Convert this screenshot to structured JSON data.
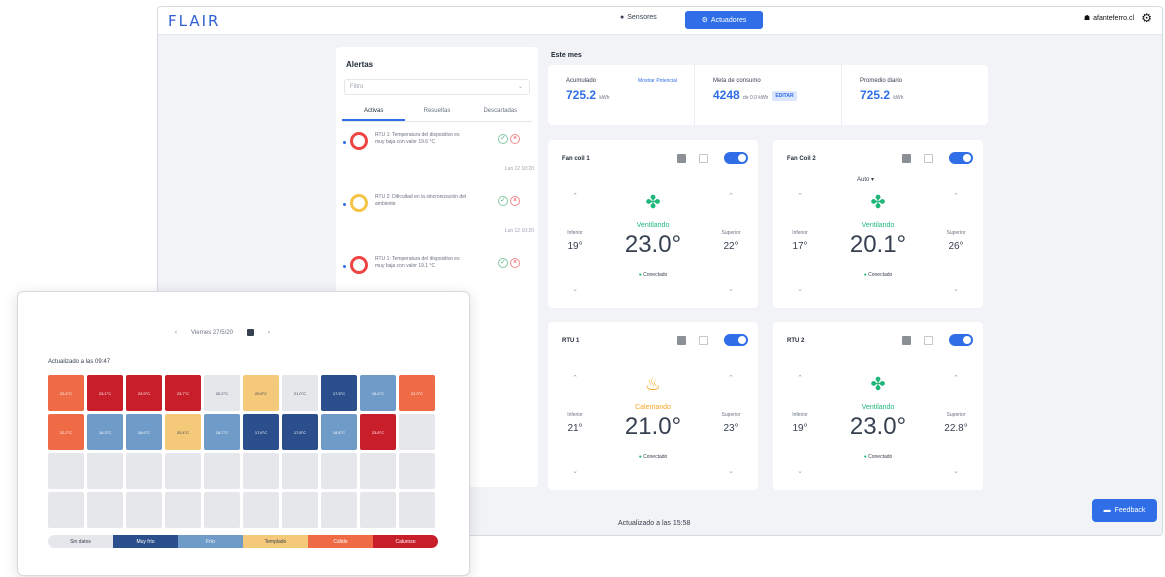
{
  "app": {
    "logo": "FLAIR"
  },
  "nav": {
    "sensores": "Sensores",
    "actuadores": "Actuadores"
  },
  "user": {
    "email": "afanteferro.cl"
  },
  "alerts": {
    "title": "Alertas",
    "filter_placeholder": "Filtro",
    "tabs": [
      "Activas",
      "Resueltas",
      "Descartadas"
    ],
    "items": [
      {
        "text": "RTU 1: Temperatura del dispositivo es muy baja con valor 19.6 °C",
        "time": "Lun 12 10:20",
        "color": "red"
      },
      {
        "text": "RTU 2: Dificultad en la sincronización del ambiente",
        "time": "Lun 12 10:20",
        "color": "yellow"
      },
      {
        "text": "RTU 1: Temperatura del dispositivo es muy baja con valor 19.1 °C",
        "time": "",
        "color": "red"
      }
    ]
  },
  "month": {
    "title": "Este mes"
  },
  "stats": [
    {
      "label": "Acumulado",
      "value": "725.2",
      "unit": "kWh",
      "link": "Mostrar Potencial",
      "chip": ""
    },
    {
      "label": "Meta de consumo",
      "value": "4248",
      "unit": "de 0.0 kWh",
      "link": "",
      "chip": "EDITAR"
    },
    {
      "label": "Promedio diario",
      "value": "725.2",
      "unit": "kWh",
      "link": "",
      "chip": ""
    }
  ],
  "cards": [
    {
      "name": "Fan coil 1",
      "modo": "",
      "mode_label": "Ventilando",
      "mode_icon": "fan-icon",
      "temp": "23.0°",
      "inferior_label": "Inferior",
      "inferior": "19°",
      "superior_label": "Superior",
      "superior": "22°",
      "status": "Conectado"
    },
    {
      "name": "Fan Coil 2",
      "modo": "Auto ▾",
      "mode_label": "Ventilando",
      "mode_icon": "fan-icon",
      "temp": "20.1°",
      "inferior_label": "Inferior",
      "inferior": "17°",
      "superior_label": "Superior",
      "superior": "26°",
      "status": "Conectado"
    },
    {
      "name": "RTU 1",
      "modo": "",
      "mode_label": "Calentando",
      "mode_icon": "flame-icon",
      "temp": "21.0°",
      "inferior_label": "Inferior",
      "inferior": "21°",
      "superior_label": "Superior",
      "superior": "23°",
      "status": "Conectado"
    },
    {
      "name": "RTU 2",
      "modo": "",
      "mode_label": "Ventilando",
      "mode_icon": "fan-icon",
      "temp": "23.0°",
      "inferior_label": "Inferior",
      "inferior": "19°",
      "superior_label": "Superior",
      "superior": "22.8°",
      "status": "Conectado"
    }
  ],
  "footer": {
    "updated": "Actualizado a las 15:58"
  },
  "feedback": {
    "label": "Feedback"
  },
  "heatmap": {
    "date": "Viernes 27/5/20",
    "updated": "Actualizado a las 09:47",
    "colors": {
      "C0": "#e5e7eb",
      "C1": "#2b4f8c",
      "C2": "#6f9bc8",
      "C3": "#f5c97a",
      "C4": "#ef6b45",
      "C5": "#c81e2a"
    },
    "cells": [
      {
        "c": "C4",
        "t": "22.4°C"
      },
      {
        "c": "C5",
        "t": "23.1°C"
      },
      {
        "c": "C5",
        "t": "23.9°C"
      },
      {
        "c": "C5",
        "t": "23.7°C"
      },
      {
        "c": "C0",
        "t": "20.2°C"
      },
      {
        "c": "C3",
        "t": "20.8°C"
      },
      {
        "c": "C0",
        "t": "21.0°C"
      },
      {
        "c": "C1",
        "t": "17.5°C"
      },
      {
        "c": "C2",
        "t": "18.4°C"
      },
      {
        "c": "C4",
        "t": "22.0°C"
      },
      {
        "c": "C4",
        "t": "22.2°C"
      },
      {
        "c": "C2",
        "t": "18.3°C"
      },
      {
        "c": "C2",
        "t": "18.6°C"
      },
      {
        "c": "C3",
        "t": "20.4°C"
      },
      {
        "c": "C2",
        "t": "18.7°C"
      },
      {
        "c": "C1",
        "t": "17.6°C"
      },
      {
        "c": "C1",
        "t": "17.8°C"
      },
      {
        "c": "C2",
        "t": "18.8°C"
      },
      {
        "c": "C5",
        "t": "23.8°C"
      },
      {
        "c": "C0",
        "t": ""
      },
      {
        "c": "C0",
        "t": ""
      },
      {
        "c": "C0",
        "t": ""
      },
      {
        "c": "C0",
        "t": ""
      },
      {
        "c": "C0",
        "t": ""
      },
      {
        "c": "C0",
        "t": ""
      },
      {
        "c": "C0",
        "t": ""
      },
      {
        "c": "C0",
        "t": ""
      },
      {
        "c": "C0",
        "t": ""
      },
      {
        "c": "C0",
        "t": ""
      },
      {
        "c": "C0",
        "t": ""
      },
      {
        "c": "C0",
        "t": ""
      },
      {
        "c": "C0",
        "t": ""
      },
      {
        "c": "C0",
        "t": ""
      },
      {
        "c": "C0",
        "t": ""
      },
      {
        "c": "C0",
        "t": ""
      },
      {
        "c": "C0",
        "t": ""
      },
      {
        "c": "C0",
        "t": ""
      },
      {
        "c": "C0",
        "t": ""
      },
      {
        "c": "C0",
        "t": ""
      },
      {
        "c": "C0",
        "t": ""
      }
    ],
    "legend": [
      {
        "label": "Sin datos",
        "c": "C0"
      },
      {
        "label": "Muy frío",
        "c": "C1"
      },
      {
        "label": "Frío",
        "c": "C2"
      },
      {
        "label": "Templado",
        "c": "C3"
      },
      {
        "label": "Cálido",
        "c": "C4"
      },
      {
        "label": "Caluroso",
        "c": "C5"
      }
    ]
  }
}
